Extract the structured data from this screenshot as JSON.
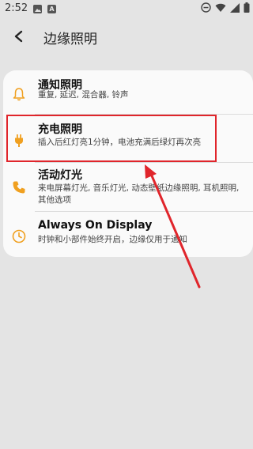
{
  "status_bar": {
    "time": "2:52",
    "notif_icons": [
      "image-notification-icon",
      "app-notification-icon"
    ],
    "notif_glyphs": [
      "",
      "A"
    ],
    "right_icons": [
      "dnd-icon",
      "wifi-icon",
      "signal-icon",
      "battery-icon"
    ]
  },
  "header": {
    "back_icon": "back-arrow-icon",
    "title": "边缘照明"
  },
  "settings": {
    "items": [
      {
        "icon": "bell-icon",
        "title": "通知照明",
        "description": "重复, 延迟, 混合器, 铃声"
      },
      {
        "icon": "plug-icon",
        "title": "充电照明",
        "description": "插入后红灯亮1分钟，电池充满后绿灯再次亮"
      },
      {
        "icon": "phone-icon",
        "title": "活动灯光",
        "description": "来电屏幕灯光, 音乐灯光, 动态壁纸边缘照明, 耳机照明, 其他选项"
      },
      {
        "icon": "clock-icon",
        "title": "Always On Display",
        "description": "时钟和小部件始终开启，边缘仅用于通知"
      }
    ]
  },
  "annotation": {
    "highlight_color": "#e0252b",
    "arrow_color": "#e0252b"
  },
  "colors": {
    "background": "#e4e4e4",
    "card": "#fafafa",
    "icon_accent": "#f0a020"
  }
}
